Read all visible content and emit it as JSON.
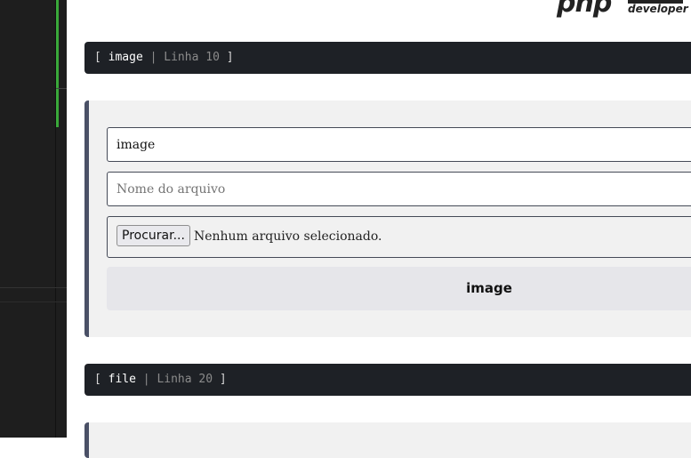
{
  "logo": {
    "mark": "php",
    "subtitle": "developer"
  },
  "sections": [
    {
      "header": {
        "open": "[ ",
        "name": "image",
        "sep": " | ",
        "line": "Linha 10",
        "close": " ]"
      },
      "form": {
        "name_value": "image",
        "filename_placeholder": "Nome do arquivo",
        "file_button": "Procurar...",
        "file_status": "Nenhum arquivo selecionado.",
        "submit_label": "image"
      }
    },
    {
      "header": {
        "open": "[ ",
        "name": "file",
        "sep": " | ",
        "line": "Linha 20",
        "close": " ]"
      }
    }
  ],
  "colors": {
    "sidebar": "#1e1e1e",
    "accent_green": "#3aa83a",
    "header_bg": "#1e2126",
    "card_bg": "#f1f1f1",
    "card_border": "#4a5066"
  }
}
